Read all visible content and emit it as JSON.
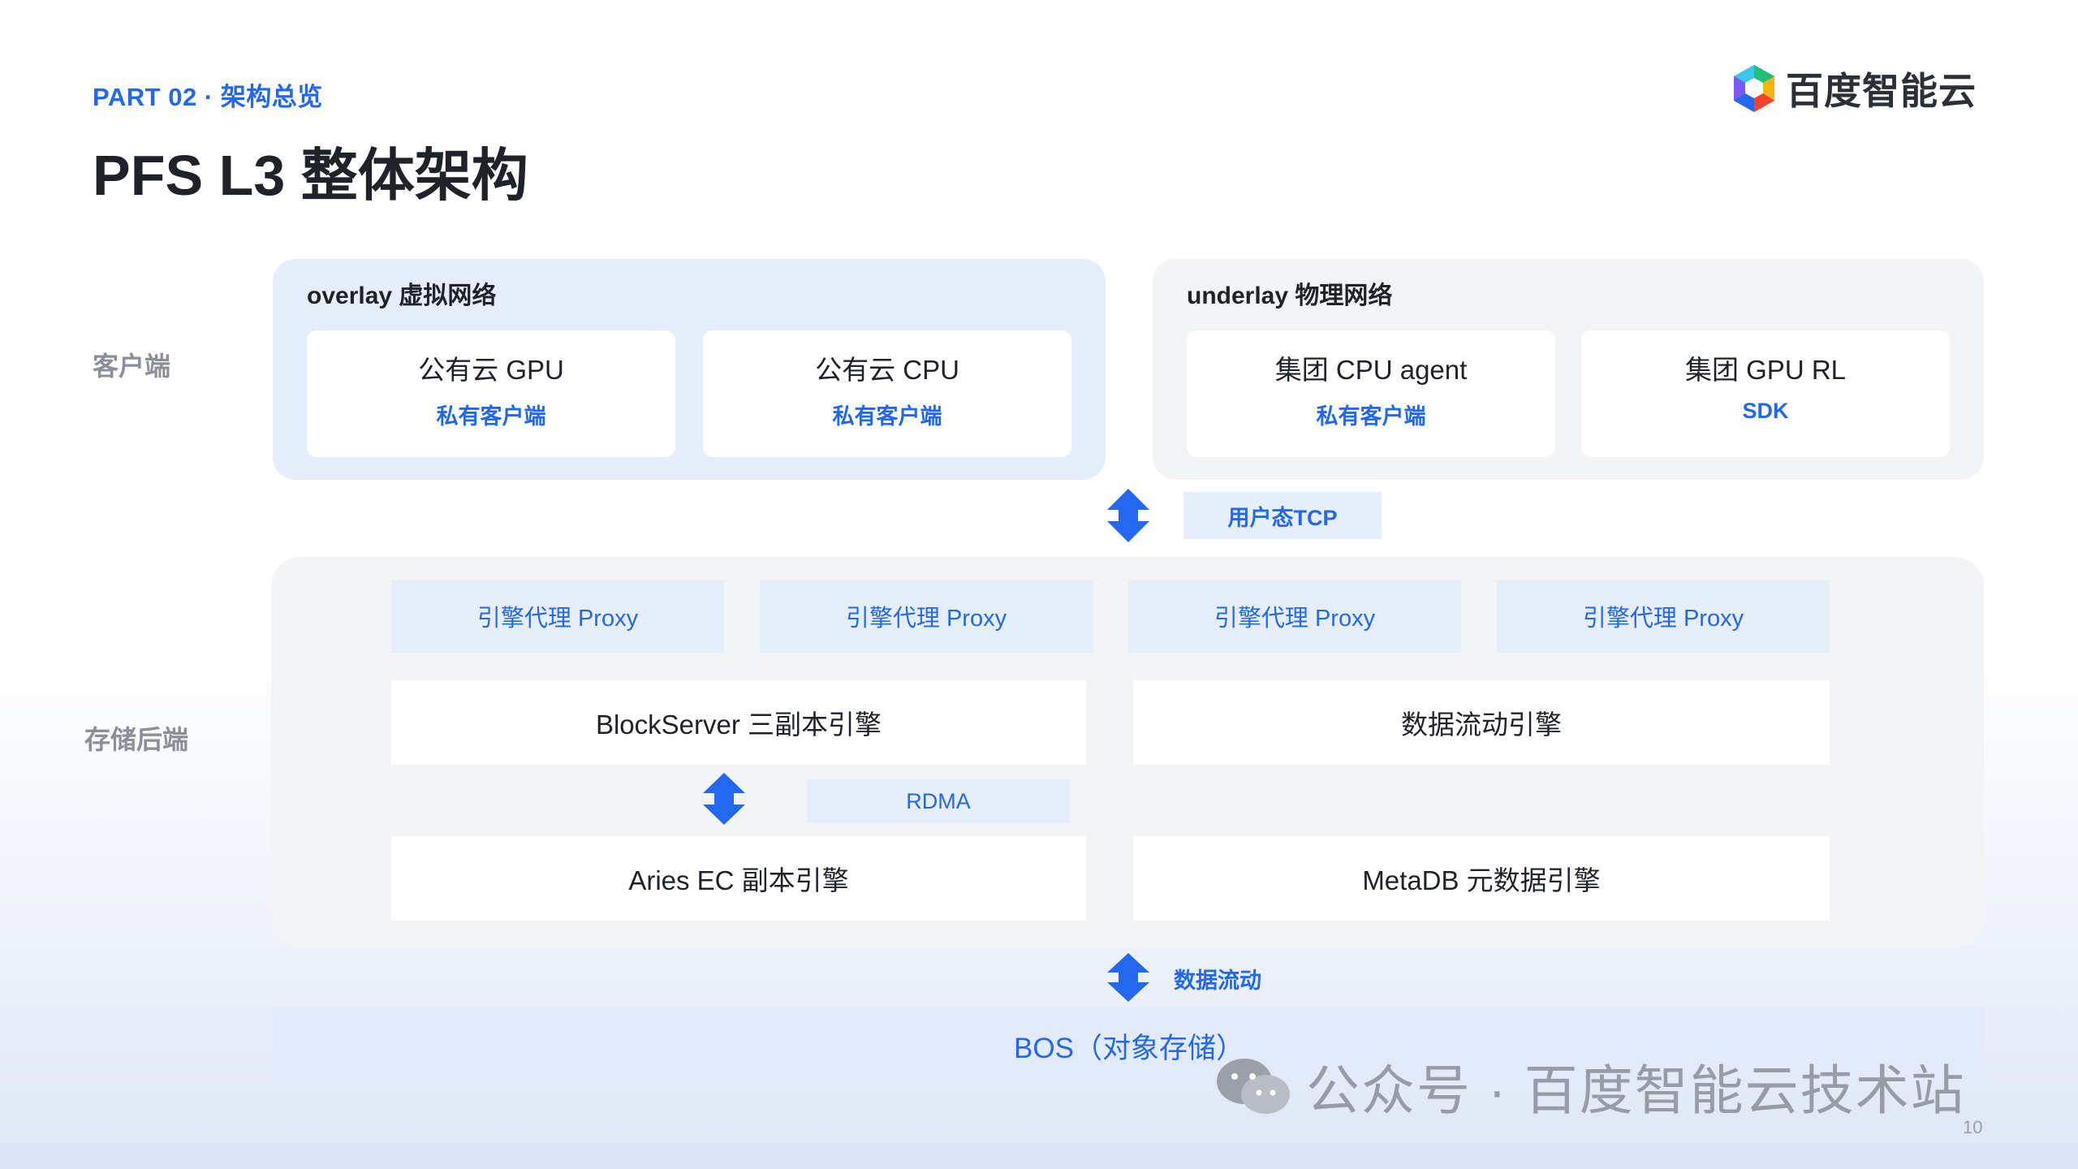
{
  "header": {
    "part": "PART 02 · 架构总览",
    "title": "PFS L3 整体架构",
    "logo_text": "百度智能云",
    "logo_icon": "baidu-cloud-hexagon-icon"
  },
  "side_labels": {
    "client": "客户端",
    "backend": "存储后端"
  },
  "client": {
    "overlay": {
      "label": "overlay 虚拟网络",
      "cards": [
        {
          "title": "公有云 GPU",
          "sub": "私有客户端"
        },
        {
          "title": "公有云 CPU",
          "sub": "私有客户端"
        }
      ]
    },
    "underlay": {
      "label": "underlay 物理网络",
      "cards": [
        {
          "title": "集团 CPU agent",
          "sub": "私有客户端"
        },
        {
          "title": "集团 GPU RL",
          "sub": "SDK"
        }
      ]
    }
  },
  "links": {
    "client_backend": "用户态TCP",
    "rdma": "RDMA",
    "backend_bos": "数据流动"
  },
  "backend": {
    "proxies": [
      "引擎代理 Proxy",
      "引擎代理 Proxy",
      "引擎代理 Proxy",
      "引擎代理 Proxy"
    ],
    "engines": {
      "blockserver": "BlockServer 三副本引擎",
      "dataflow": "数据流动引擎",
      "aries": "Aries EC 副本引擎",
      "metadb": "MetaDB 元数据引擎"
    }
  },
  "bos": "BOS（对象存储）",
  "watermark": "公众号 · 百度智能云技术站",
  "page_number": "10",
  "colors": {
    "accent": "#2468f2",
    "light_blue": "#e6eefc",
    "panel_gray": "#f3f4f6"
  }
}
